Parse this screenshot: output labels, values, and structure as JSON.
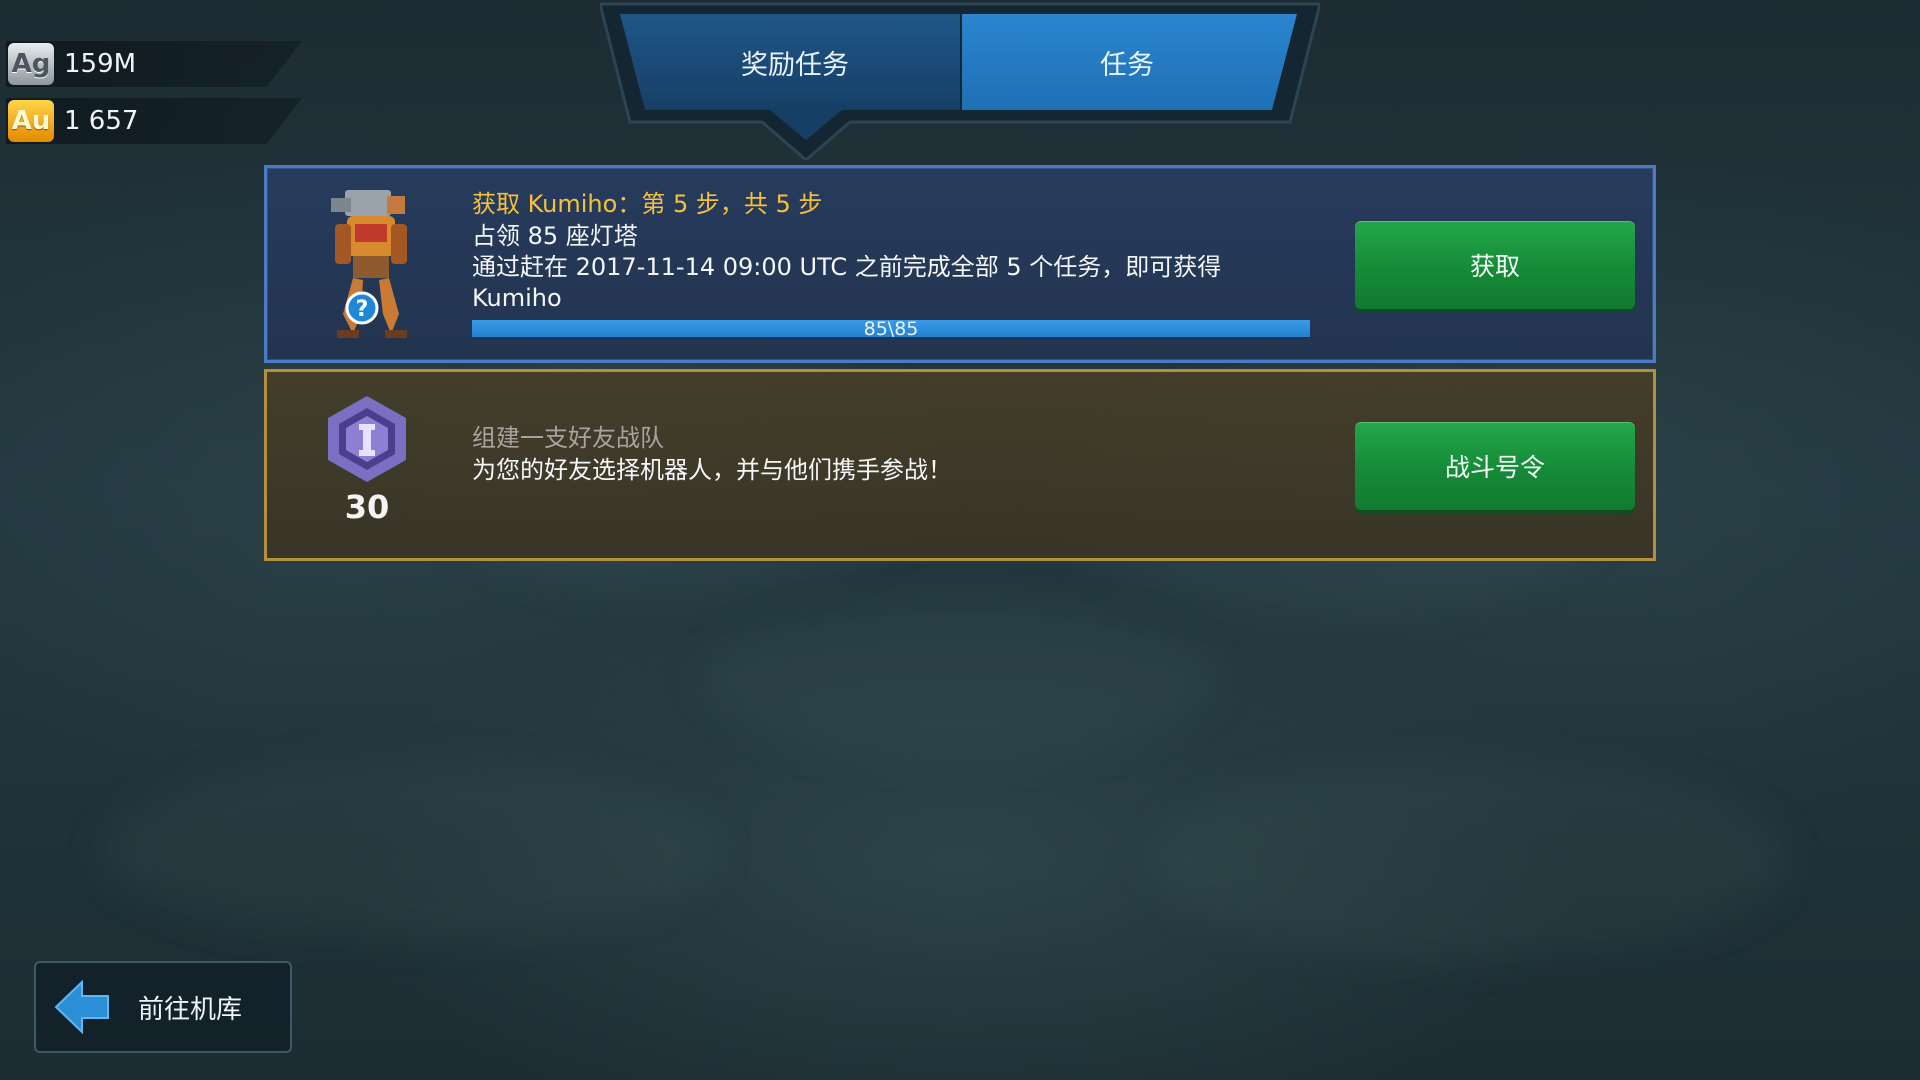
{
  "currency": {
    "silver": {
      "icon": "Ag",
      "value": "159M"
    },
    "gold": {
      "icon": "Au",
      "value": "1 657"
    }
  },
  "tabs": [
    {
      "label": "奖励任务",
      "active": false
    },
    {
      "label": "任务",
      "active": true
    }
  ],
  "quests": [
    {
      "icon": "robot-kumiho-icon",
      "title": "获取 Kumiho：第 5 步，共 5 步",
      "line1": "占领 85 座灯塔",
      "line2": "通过赶在 2017-11-14 09:00 UTC 之前完成全部 5 个任务，即可获得",
      "line3": "Kumiho",
      "progress_text": "85\\85",
      "progress": 1.0,
      "button": "获取"
    },
    {
      "icon": "squad-hexagon-icon",
      "badge_number": "30",
      "title": "组建一支好友战队",
      "line1": "为您的好友选择机器人，并与他们携手参战！",
      "button": "战斗号令"
    }
  ],
  "back_button": {
    "label": "前往机库"
  },
  "colors": {
    "quest_border": "#4d79c7",
    "squad_border": "#b38f3e",
    "quest_title": "#f7c03b",
    "button_green": "#168a38",
    "progress_fill": "#2f8fdd"
  }
}
